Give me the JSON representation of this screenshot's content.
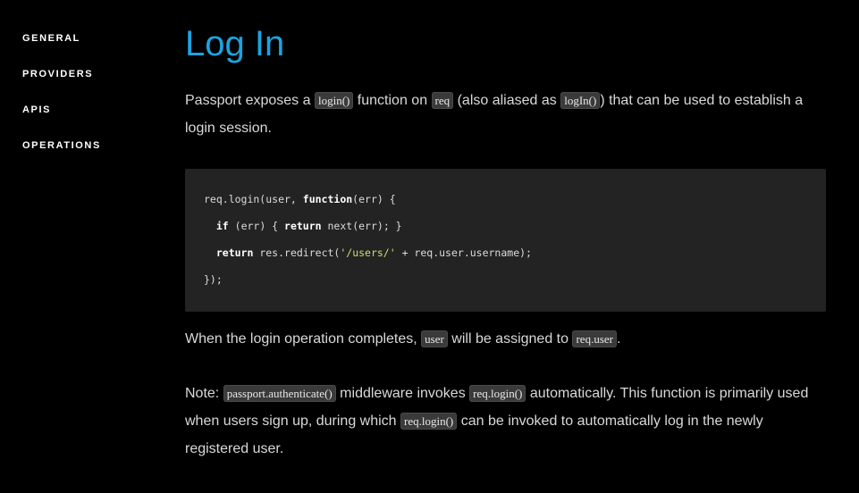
{
  "sidebar": {
    "items": [
      {
        "label": "GENERAL"
      },
      {
        "label": "PROVIDERS"
      },
      {
        "label": "APIS"
      },
      {
        "label": "OPERATIONS"
      }
    ]
  },
  "main": {
    "title": "Log In",
    "intro": {
      "t1": "Passport exposes a ",
      "c1": "login()",
      "t2": " function on ",
      "c2": "req",
      "t3": " (also aliased as ",
      "c3": "logIn()",
      "t4": ") that can be used to establish a login session."
    },
    "code": {
      "line1": {
        "a": "req.login(user, ",
        "kw": "function",
        "b": "(err) {"
      },
      "line2": {
        "indent": "  ",
        "kw1": "if",
        "a": " (err) { ",
        "kw2": "return",
        "b": " next(err); }"
      },
      "line3": {
        "indent": "  ",
        "kw": "return",
        "a": " res.redirect(",
        "str": "'/users/'",
        "b": " + req.user.username);"
      },
      "line4": {
        "a": "});"
      }
    },
    "completion": {
      "t1": "When the login operation completes, ",
      "c1": "user",
      "t2": " will be assigned to ",
      "c2": "req.user",
      "t3": "."
    },
    "note": {
      "t1": "Note: ",
      "c1": "passport.authenticate()",
      "t2": " middleware invokes ",
      "c2": "req.login()",
      "t3": " automatically. This function is primarily used when users sign up, during which ",
      "c3": "req.login()",
      "t4": " can be invoked to automatically log in the newly registered user."
    }
  }
}
